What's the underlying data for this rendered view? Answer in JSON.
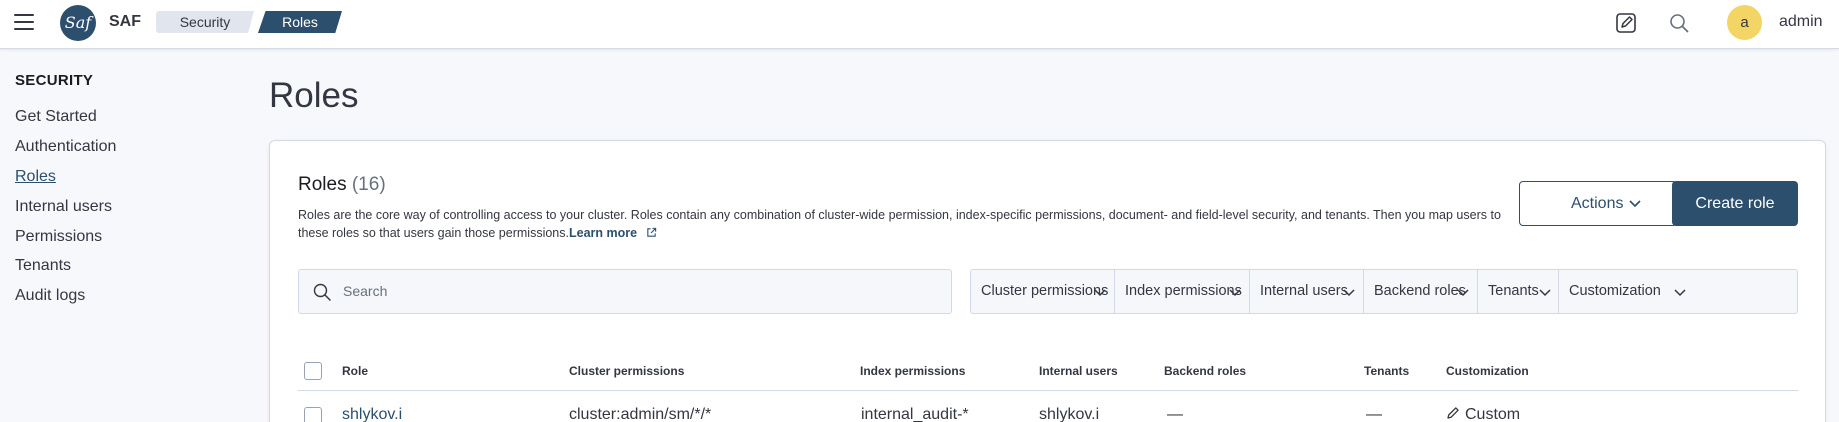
{
  "header": {
    "app_name": "SAF",
    "logo_text": "Saf",
    "breadcrumbs": [
      "Security",
      "Roles"
    ],
    "avatar_initial": "a",
    "user_name": "admin",
    "icons": [
      "menu-icon",
      "edit-icon",
      "search-icon"
    ]
  },
  "sidebar": {
    "title": "SECURITY",
    "items": [
      {
        "label": "Get Started",
        "active": false
      },
      {
        "label": "Authentication",
        "active": false
      },
      {
        "label": "Roles",
        "active": true
      },
      {
        "label": "Internal users",
        "active": false
      },
      {
        "label": "Permissions",
        "active": false
      },
      {
        "label": "Tenants",
        "active": false
      },
      {
        "label": "Audit logs",
        "active": false
      }
    ]
  },
  "main": {
    "page_title": "Roles",
    "panel": {
      "title": "Roles",
      "count": "(16)",
      "description": "Roles are the core way of controlling access to your cluster. Roles contain any combination of cluster-wide permission, index-specific permissions, document- and field-level security, and tenants. Then you map users to these roles so that users gain those permissions.",
      "learn_more": "Learn more",
      "actions_label": "Actions",
      "create_label": "Create role",
      "search_placeholder": "Search",
      "filters": [
        "Cluster permissions",
        "Index permissions",
        "Internal users",
        "Backend roles",
        "Tenants",
        "Customization"
      ],
      "columns": [
        "Role",
        "Cluster permissions",
        "Index permissions",
        "Internal users",
        "Backend roles",
        "Tenants",
        "Customization"
      ],
      "rows": [
        {
          "role": "shlykov.i",
          "cluster_permissions": "cluster:admin/sm/*/*",
          "index_permissions": "internal_audit-*",
          "internal_users": "shlykov.i",
          "backend_roles": "—",
          "tenants": "—",
          "customization": "Custom"
        }
      ]
    }
  },
  "colors": {
    "primary": "#2c4f6e",
    "avatar": "#f2d564",
    "border": "#d3dae6",
    "background": "#f7f8fc"
  }
}
